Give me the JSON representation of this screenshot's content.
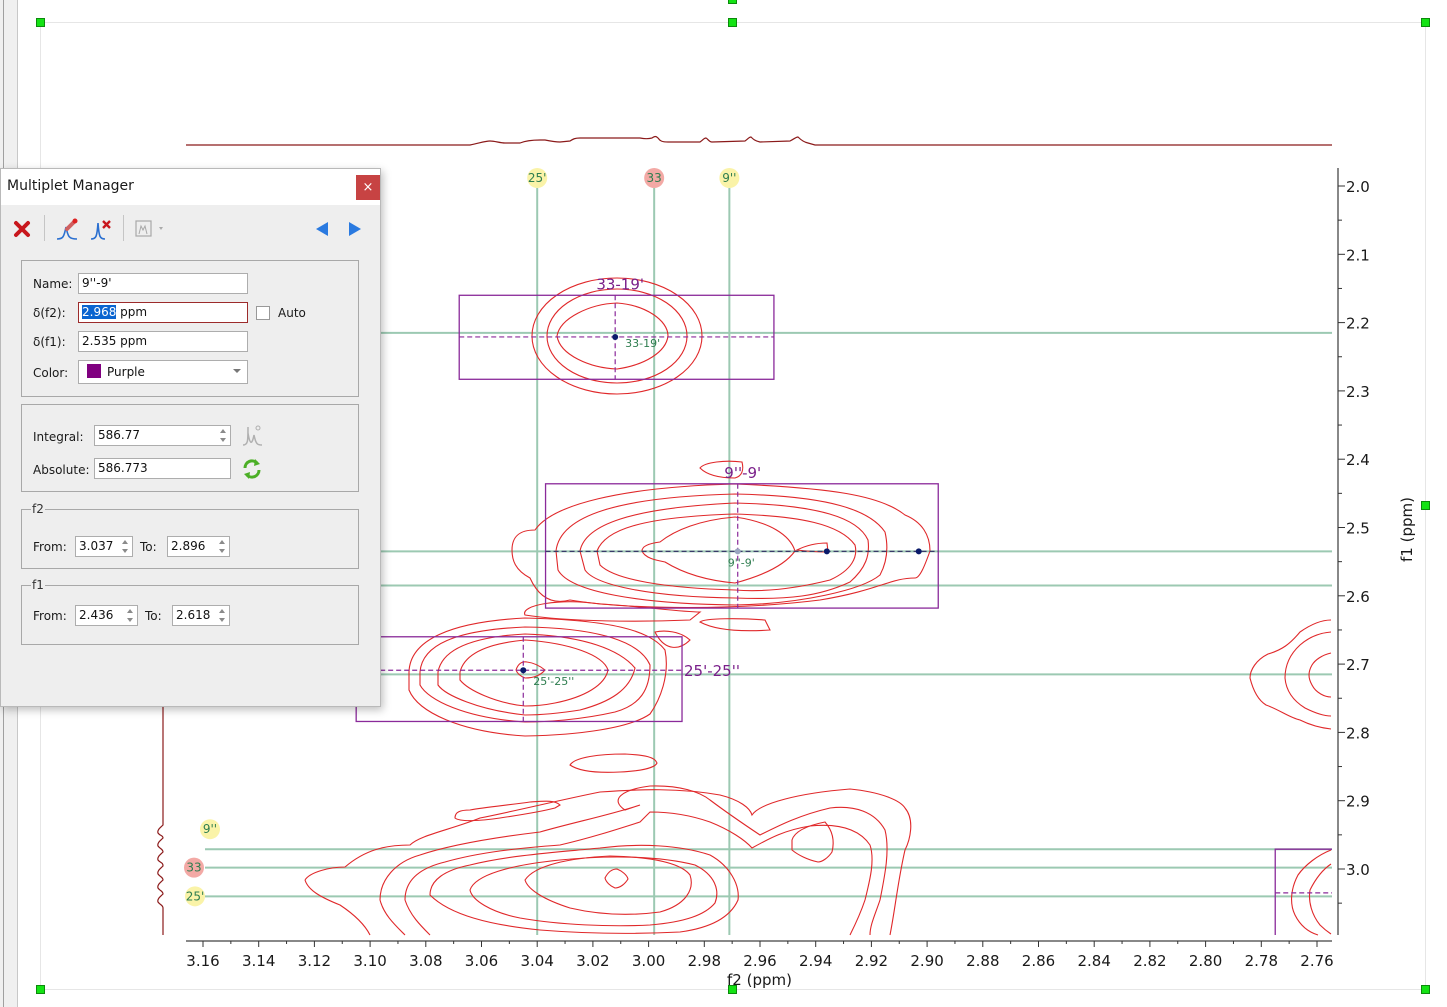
{
  "dialog": {
    "title": "Multiplet Manager",
    "close_label": "×",
    "toolbar": {
      "delete_icon": "red-x-delete-icon",
      "edit_peak_icon": "edit-peak-icon",
      "remove_peak_icon": "remove-peak-icon",
      "multiplet_analysis_icon": "multiplet-tree-icon",
      "prev_icon": "triangle-left-icon",
      "next_icon": "triangle-right-icon"
    },
    "name_label": "Name:",
    "name_value": "9''-9'",
    "df2_label": "δ(f2):",
    "df2_value_selected": "2.968",
    "df2_unit": " ppm",
    "auto_label": "Auto",
    "auto_checked": false,
    "df1_label": "δ(f1):",
    "df1_value": "2.535 ppm",
    "color_label": "Color:",
    "color_value": "Purple",
    "color_hex": "#800080",
    "integral_label": "Integral:",
    "integral_value": "586.77",
    "absolute_label": "Absolute:",
    "absolute_value": "586.773",
    "f2_group": "f2",
    "f2_from_label": "From:",
    "f2_from": "3.037",
    "f2_to_label": "To:",
    "f2_to": "2.896",
    "f1_group": "f1",
    "f1_from_label": "From:",
    "f1_from": "2.436",
    "f1_to_label": "To:",
    "f1_to": "2.618"
  },
  "spectrum": {
    "x_axis_label": "f2 (ppm)",
    "y_axis_label": "f1 (ppm)",
    "colors": {
      "contour": "#e0282a",
      "trace": "#8b1a1a",
      "multiplet_box": "#8a2a9a",
      "guide_line": "#9cc9b2",
      "label_green": "#2e7d4f",
      "label_purple": "#7a1f8a",
      "peak_dot": "#0a1a6a",
      "assign_yellow": "#faf3a8",
      "assign_red": "#f3a9a5",
      "handle": "#14e314"
    }
  },
  "chart_data": {
    "type": "contour",
    "title": "",
    "xlabel": "f2 (ppm)",
    "ylabel": "f1 (ppm)",
    "xlim": [
      3.165,
      2.755
    ],
    "ylim": [
      2.0,
      3.09
    ],
    "x_ticks": [
      "3.16",
      "3.14",
      "3.12",
      "3.10",
      "3.08",
      "3.06",
      "3.04",
      "3.02",
      "3.00",
      "2.98",
      "2.96",
      "2.94",
      "2.92",
      "2.90",
      "2.88",
      "2.86",
      "2.84",
      "2.82",
      "2.80",
      "2.78",
      "2.76"
    ],
    "y_ticks": [
      "2.0",
      "2.1",
      "2.2",
      "2.3",
      "2.4",
      "2.5",
      "2.6",
      "2.7",
      "2.8",
      "2.9",
      "3.0"
    ],
    "x_tick_values": [
      3.16,
      3.14,
      3.12,
      3.1,
      3.08,
      3.06,
      3.04,
      3.02,
      3.0,
      2.98,
      2.96,
      2.94,
      2.92,
      2.9,
      2.88,
      2.86,
      2.84,
      2.82,
      2.8,
      2.78,
      2.76
    ],
    "y_tick_values": [
      2.0,
      2.1,
      2.2,
      2.3,
      2.4,
      2.5,
      2.6,
      2.7,
      2.8,
      2.9,
      3.0
    ],
    "assignments_f2": [
      {
        "label": "25'",
        "ppm": 3.04,
        "style": "yellow"
      },
      {
        "label": "33",
        "ppm": 2.998,
        "style": "red"
      },
      {
        "label": "9''",
        "ppm": 2.971,
        "style": "yellow"
      }
    ],
    "assignments_f1": [
      {
        "label": "9''",
        "ppm": 2.971,
        "style": "yellow"
      },
      {
        "label": "33",
        "ppm": 2.998,
        "style": "red"
      },
      {
        "label": "25'",
        "ppm": 3.04,
        "style": "yellow"
      }
    ],
    "horizontal_guides_f1": [
      2.215,
      2.535,
      2.585,
      2.715,
      2.971,
      2.998,
      3.04
    ],
    "multiplets": [
      {
        "name": "33-19'",
        "f2_from": 3.068,
        "f2_to": 2.955,
        "f1_from": 2.16,
        "f1_to": 2.283,
        "center_f2": 3.012,
        "center_f1": 2.221,
        "label_pos": "top"
      },
      {
        "name": "9''-9'",
        "f2_from": 3.037,
        "f2_to": 2.896,
        "f1_from": 2.436,
        "f1_to": 2.618,
        "center_f2": 2.968,
        "center_f1": 2.535,
        "label_pos": "top",
        "extra_peaks_f2": [
          2.936,
          2.903
        ]
      },
      {
        "name": "25'-25''",
        "f2_from": 3.105,
        "f2_to": 2.988,
        "f1_from": 2.66,
        "f1_to": 2.784,
        "center_f2": 3.045,
        "center_f1": 2.709,
        "label_pos": "right"
      }
    ]
  }
}
